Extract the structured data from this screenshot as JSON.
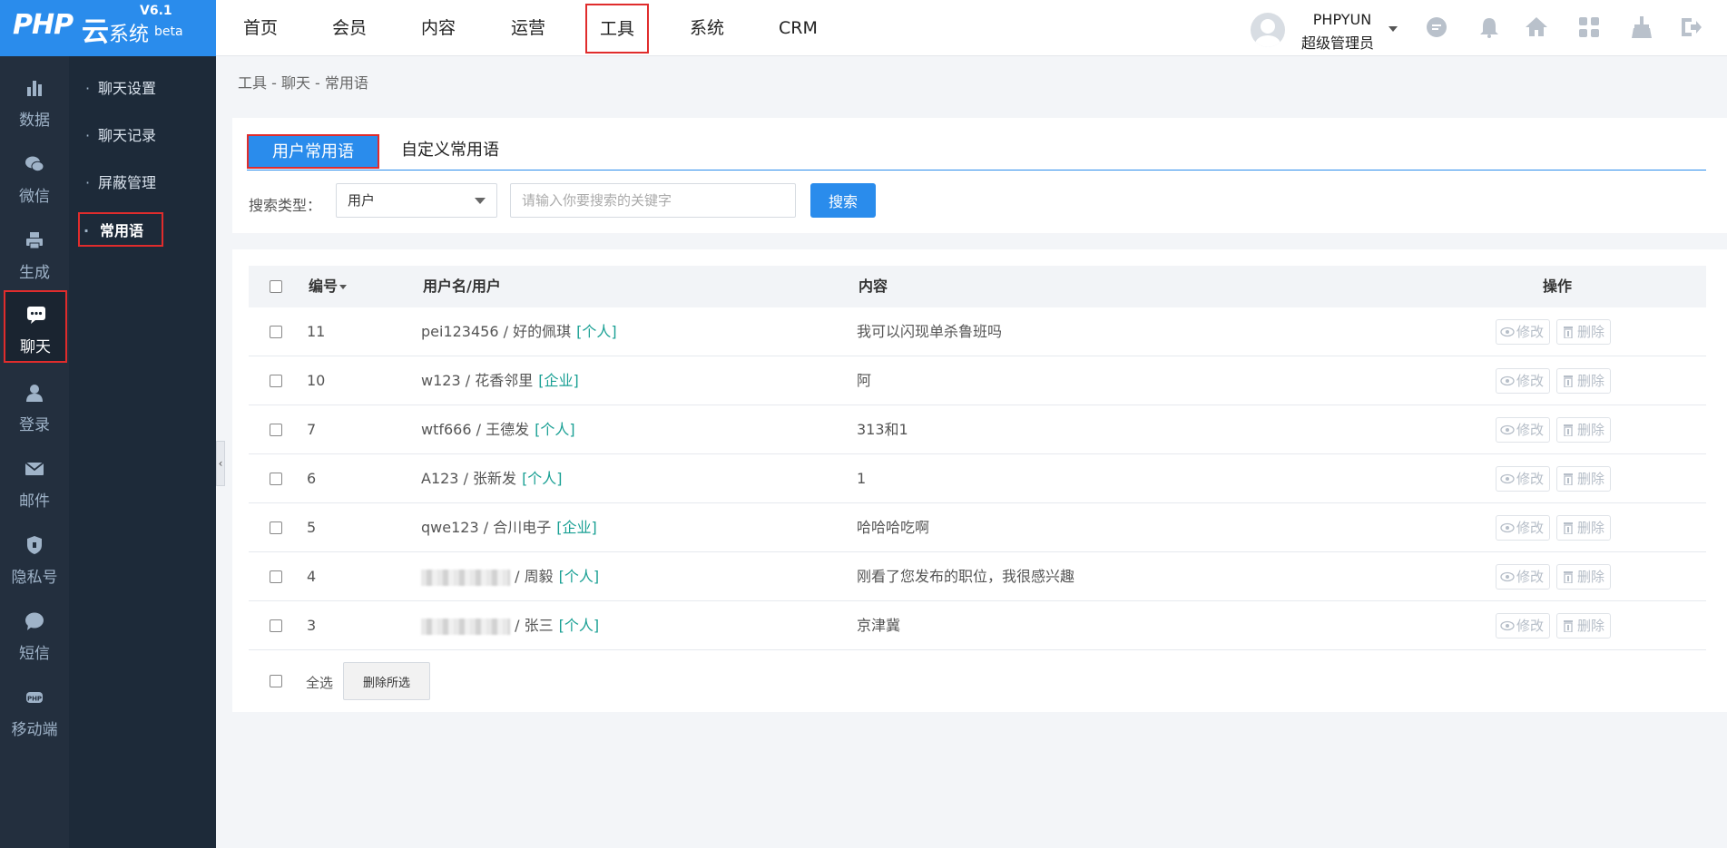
{
  "logo": {
    "php": "PHP",
    "yun": "云",
    "system": "系统",
    "version": "V6.1",
    "beta": "beta"
  },
  "sidebar": {
    "items": [
      {
        "label": "数据",
        "icon": "bar-chart-icon"
      },
      {
        "label": "微信",
        "icon": "wechat-icon"
      },
      {
        "label": "生成",
        "icon": "printer-icon"
      },
      {
        "label": "聊天",
        "icon": "chat-bubble-icon",
        "active": true
      },
      {
        "label": "登录",
        "icon": "user-icon"
      },
      {
        "label": "邮件",
        "icon": "mail-icon"
      },
      {
        "label": "隐私号",
        "icon": "shield-icon"
      },
      {
        "label": "短信",
        "icon": "message-icon"
      },
      {
        "label": "移动端",
        "icon": "mobile-app-icon"
      }
    ]
  },
  "submenu": {
    "items": [
      {
        "label": "聊天设置"
      },
      {
        "label": "聊天记录"
      },
      {
        "label": "屏蔽管理"
      },
      {
        "label": "常用语",
        "active": true
      }
    ]
  },
  "topnav": {
    "items": [
      {
        "label": "首页"
      },
      {
        "label": "会员"
      },
      {
        "label": "内容"
      },
      {
        "label": "运营"
      },
      {
        "label": "工具",
        "active": true
      },
      {
        "label": "系统"
      },
      {
        "label": "CRM"
      }
    ],
    "user": {
      "name": "PHPYUN",
      "role": "超级管理员"
    },
    "icons": [
      "chat-icon",
      "bell-icon",
      "home-icon",
      "grid-apps-icon",
      "broom-icon",
      "logout-icon"
    ]
  },
  "breadcrumb": "工具 - 聊天 - 常用语",
  "tabs": [
    {
      "label": "用户常用语",
      "active": true
    },
    {
      "label": "自定义常用语"
    }
  ],
  "search": {
    "type_label": "搜索类型：",
    "type_value": "用户",
    "placeholder": "请输入你要搜索的关键字",
    "button": "搜索"
  },
  "table": {
    "headers": {
      "id": "编号",
      "user": "用户名/用户",
      "content": "内容",
      "ops": "操作"
    },
    "rows": [
      {
        "id": "11",
        "username": "pei123456",
        "user": "好的佩琪",
        "tag": "[个人]",
        "content": "我可以闪现单杀鲁班吗",
        "blurred": false
      },
      {
        "id": "10",
        "username": "w123",
        "user": "花香邻里",
        "tag": "[企业]",
        "content": "阿",
        "blurred": false
      },
      {
        "id": "7",
        "username": "wtf666",
        "user": "王德发",
        "tag": "[个人]",
        "content": "313和1",
        "blurred": false
      },
      {
        "id": "6",
        "username": "A123",
        "user": "张新发",
        "tag": "[个人]",
        "content": "1",
        "blurred": false
      },
      {
        "id": "5",
        "username": "qwe123",
        "user": "合川电子",
        "tag": "[企业]",
        "content": "哈哈哈吃啊",
        "blurred": false
      },
      {
        "id": "4",
        "username": "",
        "user": "周毅",
        "tag": "[个人]",
        "content": "刚看了您发布的职位，我很感兴趣",
        "blurred": true
      },
      {
        "id": "3",
        "username": "",
        "user": "张三",
        "tag": "[个人]",
        "content": "京津冀",
        "blurred": true
      }
    ],
    "edit_label": "修改",
    "delete_label": "删除",
    "select_all": "全选",
    "delete_selected": "删除所选"
  },
  "colors": {
    "primary": "#2a8cec",
    "sidebar": "#232f3e",
    "submenu": "#1d2a39",
    "highlight": "#e02c2c",
    "tag": "#1aa094"
  }
}
